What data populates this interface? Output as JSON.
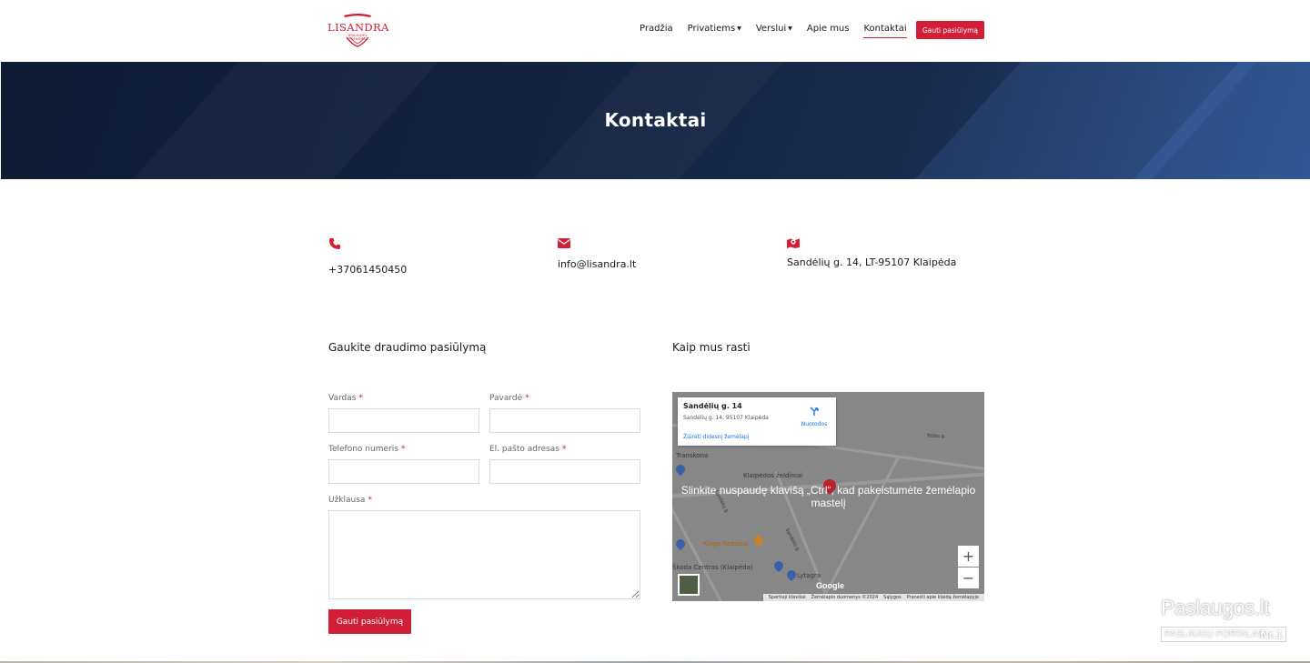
{
  "brand": {
    "name": "LISANDRA",
    "tagline": "DRAUDIMO SPRENDIMAI",
    "color": "#d11f37"
  },
  "nav": {
    "items": [
      {
        "label": "Pradžia"
      },
      {
        "label": "Privatiems",
        "has_dropdown": true
      },
      {
        "label": "Verslui",
        "has_dropdown": true
      },
      {
        "label": "Apie mus"
      },
      {
        "label": "Kontaktai",
        "active": true
      }
    ],
    "cta_label": "Gauti pasiūlymą"
  },
  "hero": {
    "title": "Kontaktai"
  },
  "contacts": {
    "phone": {
      "icon": "phone-icon",
      "text": "+37061450450"
    },
    "email": {
      "icon": "envelope-icon",
      "text": "info@lisandra.lt"
    },
    "address": {
      "icon": "map-marker-icon",
      "text": "Sandėlių g. 14, LT-95107 Klaipėda"
    }
  },
  "form": {
    "title": "Gaukite draudimo pasiūlymą",
    "required_mark": "*",
    "fields": {
      "first_name": {
        "label": "Vardas",
        "value": ""
      },
      "last_name": {
        "label": "Pavardė",
        "value": ""
      },
      "phone": {
        "label": "Telefono numeris",
        "value": ""
      },
      "email": {
        "label": "El. pašto adresas",
        "value": ""
      },
      "message": {
        "label": "Užklausa",
        "value": ""
      }
    },
    "submit_label": "Gauti pasiūlymą"
  },
  "map": {
    "title": "Kaip mus rasti",
    "card_title": "Sandėlių g. 14",
    "card_address": "Sandėlių g. 14, 95107 Klaipėda",
    "directions_label": "Nuorodos",
    "larger_map_link": "Žiūrėti didesnį žemėlapį",
    "overlay_message": "Slinkite nuspaudę klavišą „Ctrl“, kad pakeistumėte žemėlapio mastelį",
    "zoom_in": "+",
    "zoom_out": "−",
    "google_logo": "Google",
    "attribution": [
      "Spartieji klavišai",
      "Žemėlapio duomenys ©2024",
      "Sąlygos",
      "Pranešti apie klaidą žemėlapyje"
    ],
    "places": [
      "Transkona",
      "Klaipėdos želdiniai",
      "Kingo Kebabai",
      "Škoda Centras (Klaipėda)",
      "Lytagra",
      "Sandėlio g.",
      "Sandėlių g.",
      "Tilžės g."
    ]
  },
  "watermark": {
    "line1": "Paslaugos.lt",
    "line2": "PASLAUGŲ PORTALAS",
    "badge": "Nr.1"
  }
}
